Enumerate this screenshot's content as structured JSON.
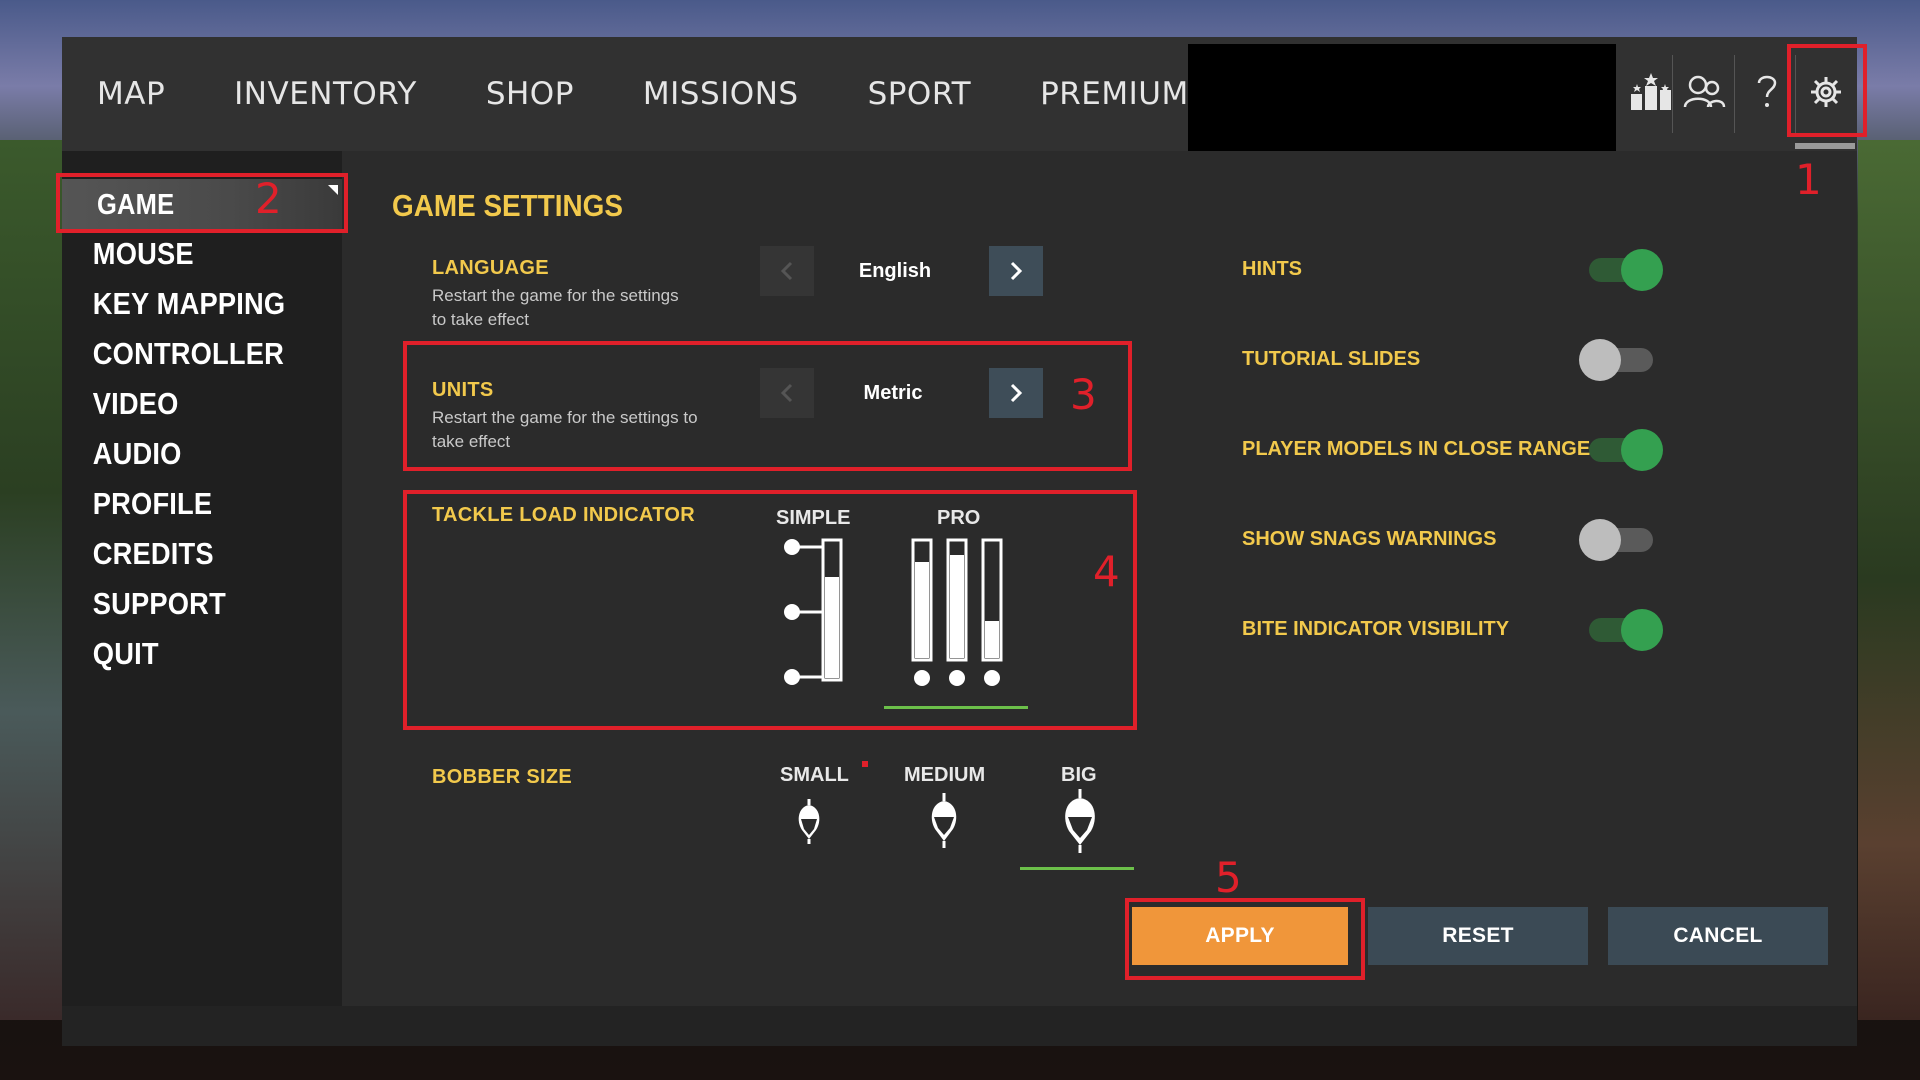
{
  "topnav": {
    "tabs": [
      "MAP",
      "INVENTORY",
      "SHOP",
      "MISSIONS",
      "SPORT",
      "PREMIUM"
    ]
  },
  "sidebar": {
    "items": [
      "GAME",
      "MOUSE",
      "KEY MAPPING",
      "CONTROLLER",
      "VIDEO",
      "AUDIO",
      "PROFILE",
      "CREDITS",
      "SUPPORT",
      "QUIT"
    ],
    "active": "GAME"
  },
  "settings": {
    "title": "GAME SETTINGS",
    "language": {
      "label": "LANGUAGE",
      "sub1": "Restart the game for the settings",
      "sub2": "to take effect",
      "value": "English"
    },
    "units": {
      "label": "UNITS",
      "sub1": "Restart the game for the settings to",
      "sub2": "take effect",
      "value": "Metric"
    },
    "tackle": {
      "label": "TACKLE LOAD INDICATOR",
      "options": [
        "SIMPLE",
        "PRO"
      ],
      "selected": "PRO"
    },
    "bobber": {
      "label": "BOBBER SIZE",
      "options": [
        "SMALL",
        "MEDIUM",
        "BIG"
      ],
      "selected": "BIG"
    },
    "toggles": [
      {
        "label": "HINTS",
        "on": true
      },
      {
        "label": "TUTORIAL SLIDES",
        "on": false
      },
      {
        "label": "PLAYER MODELS IN CLOSE RANGE",
        "on": true
      },
      {
        "label": "SHOW SNAGS WARNINGS",
        "on": false
      },
      {
        "label": "BITE INDICATOR VISIBILITY",
        "on": true
      }
    ]
  },
  "buttons": {
    "apply": "APPLY",
    "reset": "RESET",
    "cancel": "CANCEL"
  },
  "annotations": [
    "1",
    "2",
    "3",
    "4",
    "5"
  ],
  "colors": {
    "accent_yellow": "#f2c94c",
    "apply_orange": "#f0963a",
    "highlight_red": "#e0202a",
    "toggle_on": "#34a050"
  }
}
